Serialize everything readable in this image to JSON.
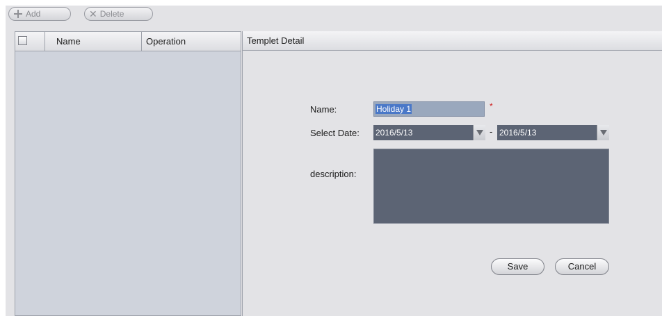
{
  "toolbar": {
    "add_label": "Add",
    "delete_label": "Delete"
  },
  "list": {
    "columns": [
      "Name",
      "Operation"
    ],
    "rows": []
  },
  "detail": {
    "header": "Templet Detail",
    "name_label": "Name:",
    "name_value": "Holiday 1",
    "required_mark": "*",
    "date_label": "Select Date:",
    "date_from": "2016/5/13",
    "date_separator": "-",
    "date_to": "2016/5/13",
    "description_label": "description:",
    "description_value": "",
    "save_label": "Save",
    "cancel_label": "Cancel"
  },
  "colors": {
    "panel_bg": "#e3e3e6",
    "list_bg": "#cfd3dc",
    "field_dark": "#5c6474",
    "selection": "#4a78c8",
    "required": "#d02020"
  },
  "icons": {
    "add": "plus-icon",
    "delete": "close-icon",
    "dropdown": "chevron-down-icon"
  }
}
